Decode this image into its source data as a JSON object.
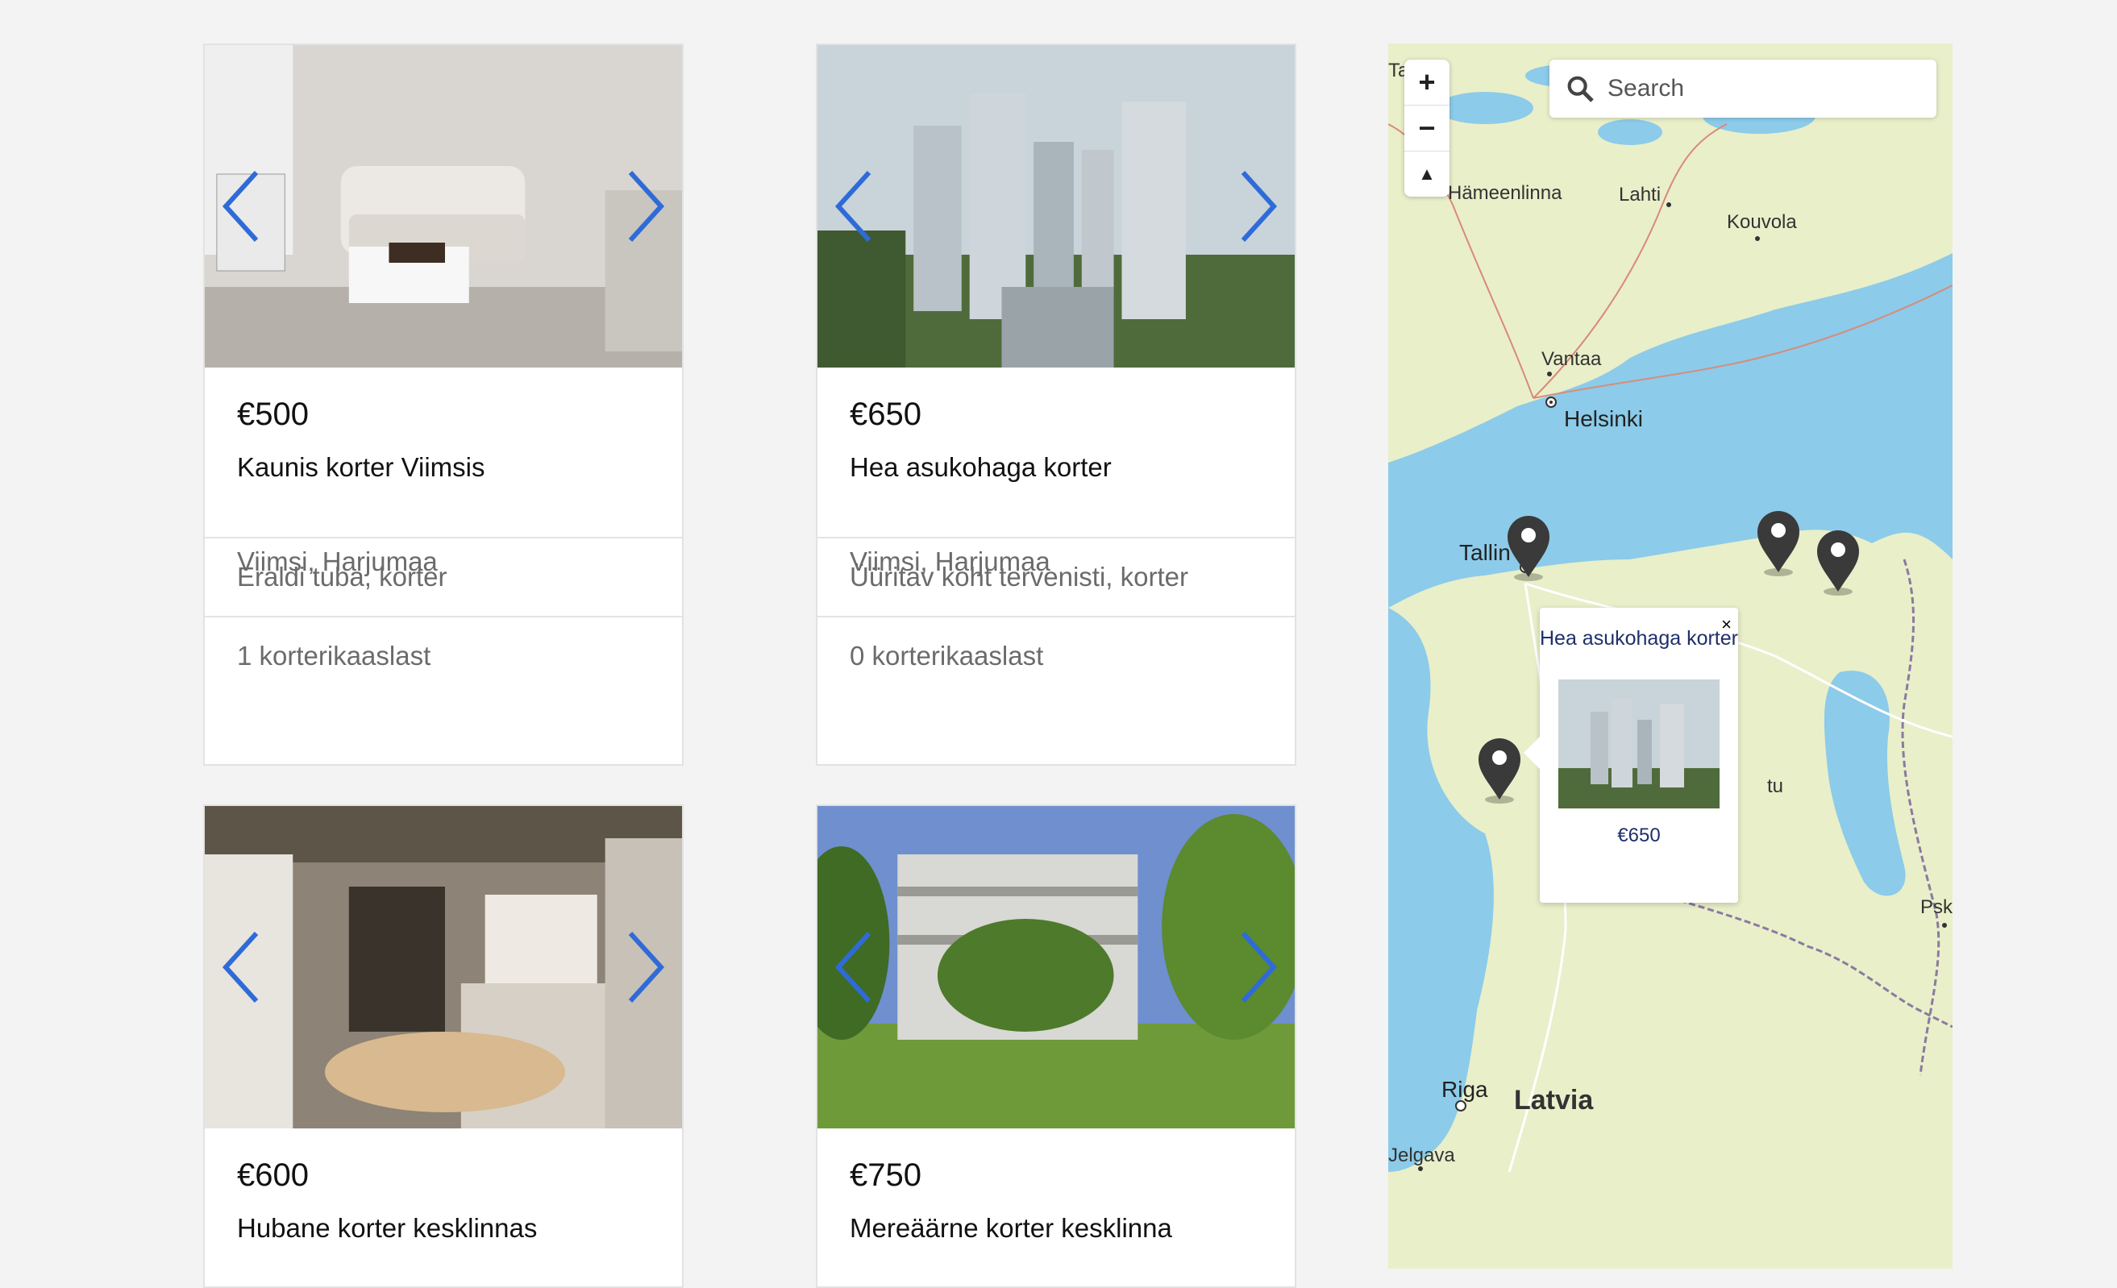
{
  "listings": [
    {
      "price": "€500",
      "title": "Kaunis korter Viimsis",
      "location": "Viimsi, Harjumaa",
      "room_type": "Eraldi tuba, korter",
      "roommates": "1 korterikaaslast"
    },
    {
      "price": "€650",
      "title": "Hea asukohaga korter",
      "location": "Viimsi, Harjumaa",
      "room_type": "Üüritav koht tervenisti, korter",
      "roommates": "0 korterikaaslast"
    },
    {
      "price": "€600",
      "title": "Hubane korter kesklinnas"
    },
    {
      "price": "€750",
      "title": "Mereäärne korter kesklinna"
    }
  ],
  "map": {
    "search_placeholder": "Search",
    "zoom_in": "+",
    "zoom_out": "−",
    "compass": "▲",
    "labels": {
      "tampere": "Ta",
      "hameenlinna": "Hämeenlinna",
      "lahti": "Lahti",
      "kouvola": "Kouvola",
      "vantaa": "Vantaa",
      "helsinki": "Helsinki",
      "tallinn": "Tallin",
      "tartu": "tu",
      "pskov": "Psk",
      "riga": "Riga",
      "latvia": "Latvia",
      "jelgava": "Jelgava"
    },
    "popup": {
      "title": "Hea asukohaga korter",
      "price": "€650",
      "close": "×"
    },
    "colors": {
      "water": "#8ccbe9",
      "land": "#e9efc9",
      "pin": "#3a3a3a",
      "arrow": "#2f6bd8"
    }
  }
}
